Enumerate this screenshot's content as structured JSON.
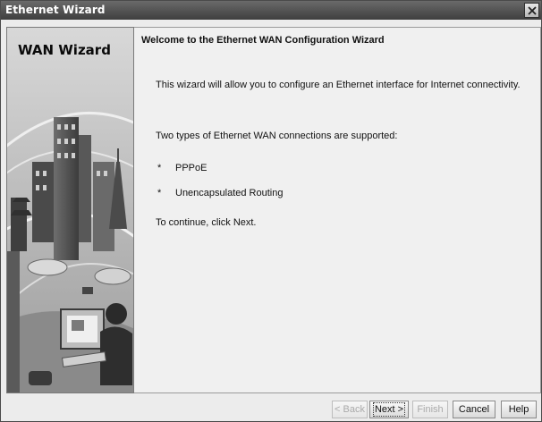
{
  "window": {
    "title": "Ethernet Wizard"
  },
  "side_panel": {
    "title": "WAN Wizard"
  },
  "content": {
    "heading": "Welcome to the Ethernet WAN Configuration Wizard",
    "intro": "This wizard will allow you to configure an Ethernet interface for Internet connectivity.",
    "types_intro": "Two types of Ethernet WAN connections are supported:",
    "bullets": [
      {
        "marker": "*",
        "text": "PPPoE"
      },
      {
        "marker": "*",
        "text": "Unencapsulated Routing"
      }
    ],
    "continue": "To continue, click Next."
  },
  "buttons": {
    "back": "< Back",
    "next": "Next >",
    "finish": "Finish",
    "cancel": "Cancel",
    "help": "Help"
  }
}
